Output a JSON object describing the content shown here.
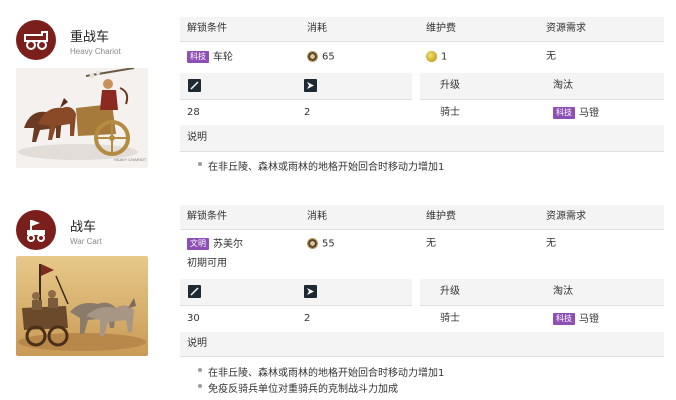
{
  "units": [
    {
      "name": "重战车",
      "name_en": "Heavy Chariot",
      "image_caption": "HEAVY CHARIOT",
      "headers": {
        "unlock": "解锁条件",
        "cost": "消耗",
        "maintenance": "维护费",
        "resource": "资源需求"
      },
      "unlock": {
        "badge": "科技",
        "value": "车轮",
        "note": ""
      },
      "cost": "65",
      "maintenance": "1",
      "resource": "无",
      "combat_value": "28",
      "move_value": "2",
      "upgrade_header": "升级",
      "upgrade_value": "骑士",
      "obsolete_header": "淘汰",
      "obsolete_badge": "科技",
      "obsolete_value": "马镫",
      "desc_header": "说明",
      "desc": [
        "在非丘陵、森林或雨林的地格开始回合时移动力增加1"
      ]
    },
    {
      "name": "战车",
      "name_en": "War Cart",
      "headers": {
        "unlock": "解锁条件",
        "cost": "消耗",
        "maintenance": "维护费",
        "resource": "资源需求"
      },
      "unlock": {
        "badge": "文明",
        "value": "苏美尔",
        "note": "初期可用"
      },
      "cost": "55",
      "maintenance": "无",
      "resource": "无",
      "combat_value": "30",
      "move_value": "2",
      "upgrade_header": "升级",
      "upgrade_value": "骑士",
      "obsolete_header": "淘汰",
      "obsolete_badge": "科技",
      "obsolete_value": "马镫",
      "desc_header": "说明",
      "desc": [
        "在非丘陵、森林或雨林的地格开始回合时移动力增加1",
        "免疫反骑兵单位对重骑兵的克制战斗力加成"
      ]
    }
  ],
  "colors": {
    "unit_icon_bg": "#7a1f1c",
    "badge_purple": "#8d4fb5",
    "stat_icon_bg": "#1e2a33"
  },
  "icons": {
    "unit0": "chariot-icon",
    "unit1": "war-cart-icon",
    "combat": "sword-icon",
    "move": "arrow-icon",
    "cost": "production-icon",
    "maintenance": "gold-icon"
  }
}
